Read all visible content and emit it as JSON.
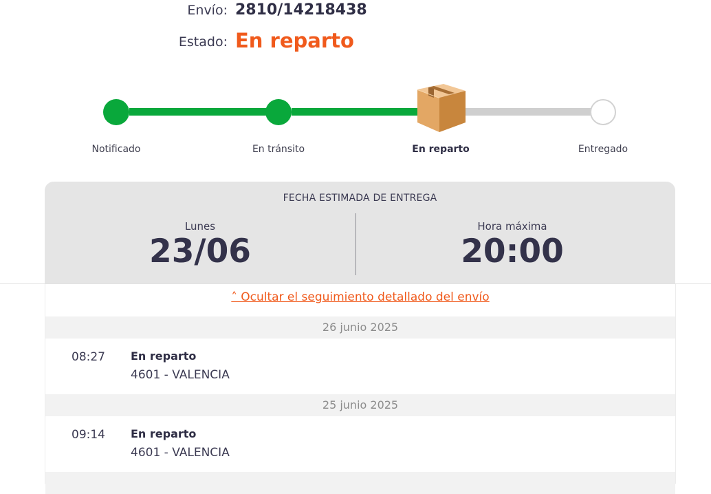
{
  "header": {
    "envio_label": "Envío:",
    "envio_value": "2810/14218438",
    "estado_label": "Estado:",
    "estado_value": "En reparto"
  },
  "colors": {
    "accent": "#f05a1c",
    "done": "#09a83b",
    "pending": "#d2d2d2",
    "text": "#3b3a52"
  },
  "tracker": {
    "steps": [
      {
        "label": "Notificado",
        "state": "done"
      },
      {
        "label": "En tránsito",
        "state": "done"
      },
      {
        "label": "En reparto",
        "state": "current",
        "icon": "package-box-icon"
      },
      {
        "label": "Entregado",
        "state": "pending"
      }
    ]
  },
  "delivery": {
    "title": "FECHA ESTIMADA DE ENTREGA",
    "day_label": "Lunes",
    "date": "23/06",
    "time_label": "Hora máxima",
    "time": "20:00"
  },
  "detail": {
    "toggle_label": "˄ Ocultar el seguimiento detallado del envío",
    "groups": [
      {
        "date": "26 junio 2025",
        "events": [
          {
            "time": "08:27",
            "status": "En reparto",
            "location": "4601 - VALENCIA"
          }
        ]
      },
      {
        "date": "25 junio 2025",
        "events": [
          {
            "time": "09:14",
            "status": "En reparto",
            "location": "4601 - VALENCIA"
          }
        ]
      }
    ]
  }
}
